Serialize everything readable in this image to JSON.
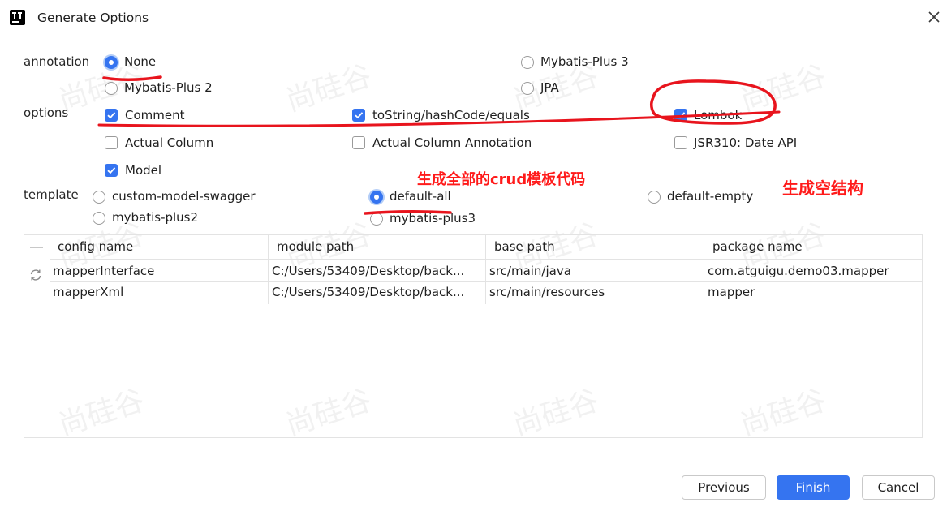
{
  "window": {
    "title": "Generate Options"
  },
  "annotation": {
    "label": "annotation",
    "options": [
      "None",
      "Mybatis-Plus 3",
      "Mybatis-Plus 2",
      "JPA"
    ],
    "selected": "None"
  },
  "options": {
    "label": "options",
    "items": [
      {
        "label": "Comment",
        "checked": true
      },
      {
        "label": "toString/hashCode/equals",
        "checked": true
      },
      {
        "label": "Lombok",
        "checked": true
      },
      {
        "label": "Actual Column",
        "checked": false
      },
      {
        "label": "Actual Column Annotation",
        "checked": false
      },
      {
        "label": "JSR310: Date API",
        "checked": false
      },
      {
        "label": "Model",
        "checked": true
      }
    ]
  },
  "template": {
    "label": "template",
    "options": [
      "custom-model-swagger",
      "default-all",
      "default-empty",
      "mybatis-plus2",
      "mybatis-plus3"
    ],
    "selected": "default-all"
  },
  "table": {
    "columns": [
      "config name",
      "module path",
      "base path",
      "package name"
    ],
    "rows": [
      [
        "mapperInterface",
        "C:/Users/53409/Desktop/back...",
        "src/main/java",
        "com.atguigu.demo03.mapper"
      ],
      [
        "mapperXml",
        "C:/Users/53409/Desktop/back...",
        "src/main/resources",
        "mapper"
      ]
    ]
  },
  "buttons": {
    "previous": "Previous",
    "finish": "Finish",
    "cancel": "Cancel"
  },
  "annotations": {
    "crud_note": "生成全部的crud模板代码",
    "empty_note": "生成空结构"
  },
  "watermark": "尚硅谷",
  "colors": {
    "accent": "#3574f0",
    "annotation_red": "#e8141d"
  }
}
